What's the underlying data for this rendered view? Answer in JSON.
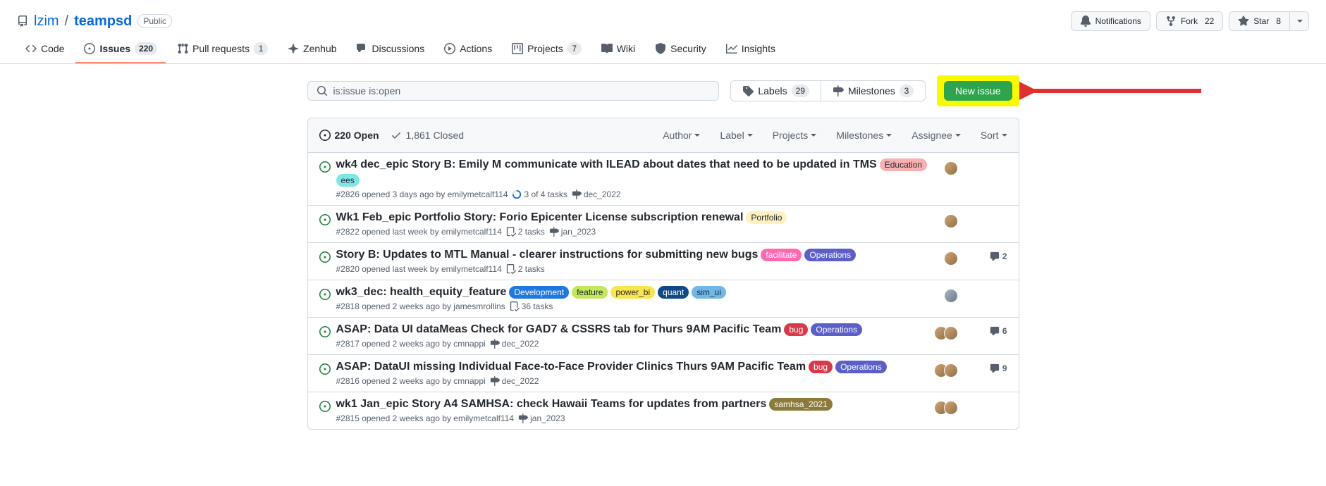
{
  "repo": {
    "owner": "lzim",
    "name": "teampsd",
    "visibility": "Public"
  },
  "headerButtons": {
    "notifications": "Notifications",
    "fork": "Fork",
    "fork_count": "22",
    "star": "Star",
    "star_count": "8"
  },
  "tabs": [
    {
      "label": "Code",
      "icon": "code"
    },
    {
      "label": "Issues",
      "icon": "issue",
      "count": "220",
      "selected": true
    },
    {
      "label": "Pull requests",
      "icon": "pr",
      "count": "1"
    },
    {
      "label": "Zenhub",
      "icon": "zenhub"
    },
    {
      "label": "Discussions",
      "icon": "discussion"
    },
    {
      "label": "Actions",
      "icon": "play"
    },
    {
      "label": "Projects",
      "icon": "project",
      "count": "7"
    },
    {
      "label": "Wiki",
      "icon": "book"
    },
    {
      "label": "Security",
      "icon": "shield"
    },
    {
      "label": "Insights",
      "icon": "graph"
    }
  ],
  "search": {
    "value": "is:issue is:open"
  },
  "filterButtons": {
    "labels": "Labels",
    "labels_count": "29",
    "milestones": "Milestones",
    "milestones_count": "3"
  },
  "newIssue": "New issue",
  "states": {
    "open": "220 Open",
    "closed": "1,861 Closed"
  },
  "sortFilters": [
    "Author",
    "Label",
    "Projects",
    "Milestones",
    "Assignee",
    "Sort"
  ],
  "issues": [
    {
      "title": "wk4 dec_epic Story B: Emily M communicate with ILEAD about dates that need to be updated in TMS",
      "labels": [
        {
          "text": "Education",
          "bg": "#f8b0b0",
          "fg": "#24292f"
        },
        {
          "text": "ees",
          "bg": "#7fe6e6",
          "fg": "#24292f"
        }
      ],
      "meta": "#2826 opened 3 days ago by emilymetcalf114",
      "tasks": {
        "kind": "progress",
        "text": "3 of 4 tasks"
      },
      "milestone": "dec_2022",
      "assignees": 1,
      "comments": null
    },
    {
      "title": "Wk1 Feb_epic Portfolio Story: Forio Epicenter License subscription renewal",
      "labels": [
        {
          "text": "Portfolio",
          "bg": "#fef2c0",
          "fg": "#24292f"
        }
      ],
      "meta": "#2822 opened last week by emilymetcalf114",
      "tasks": {
        "kind": "check",
        "text": "2 tasks"
      },
      "milestone": "jan_2023",
      "assignees": 1,
      "comments": null
    },
    {
      "title": "Story B: Updates to MTL Manual - clearer instructions for submitting new bugs",
      "labels": [
        {
          "text": "facilitate",
          "bg": "#ff69b4",
          "fg": "#fff"
        },
        {
          "text": "Operations",
          "bg": "#5b5fc7",
          "fg": "#fff"
        }
      ],
      "meta": "#2820 opened last week by emilymetcalf114",
      "tasks": {
        "kind": "check",
        "text": "2 tasks"
      },
      "milestone": null,
      "assignees": 1,
      "comments": 2
    },
    {
      "title": "wk3_dec: health_equity_feature",
      "labels": [
        {
          "text": "Development",
          "bg": "#1f77e0",
          "fg": "#fff"
        },
        {
          "text": "feature",
          "bg": "#c2e85b",
          "fg": "#24292f"
        },
        {
          "text": "power_bi",
          "bg": "#f9e64f",
          "fg": "#24292f"
        },
        {
          "text": "quant",
          "bg": "#0e4a8a",
          "fg": "#fff"
        },
        {
          "text": "sim_ui",
          "bg": "#6fb8e8",
          "fg": "#24292f"
        }
      ],
      "meta": "#2818 opened 2 weeks ago by jamesmrollins",
      "tasks": {
        "kind": "check",
        "text": "36 tasks"
      },
      "milestone": null,
      "assignees": 1,
      "assignee_male": true,
      "comments": null
    },
    {
      "title": "ASAP: Data UI dataMeas Check for GAD7 & CSSRS tab for Thurs 9AM Pacific Team",
      "labels": [
        {
          "text": "bug",
          "bg": "#d73a4a",
          "fg": "#fff"
        },
        {
          "text": "Operations",
          "bg": "#5b5fc7",
          "fg": "#fff"
        }
      ],
      "meta": "#2817 opened 2 weeks ago by cmnappi",
      "tasks": null,
      "milestone": "dec_2022",
      "assignees": 2,
      "comments": 6
    },
    {
      "title": "ASAP: DataUI missing Individual Face-to-Face Provider Clinics Thurs 9AM Pacific Team",
      "labels": [
        {
          "text": "bug",
          "bg": "#d73a4a",
          "fg": "#fff"
        },
        {
          "text": "Operations",
          "bg": "#5b5fc7",
          "fg": "#fff"
        }
      ],
      "meta": "#2816 opened 2 weeks ago by cmnappi",
      "tasks": null,
      "milestone": "dec_2022",
      "assignees": 2,
      "comments": 9
    },
    {
      "title": "wk1 Jan_epic Story A4 SAMHSA: check Hawaii Teams for updates from partners",
      "labels": [
        {
          "text": "samhsa_2021",
          "bg": "#8b7a3a",
          "fg": "#fff"
        }
      ],
      "meta": "#2815 opened 2 weeks ago by emilymetcalf114",
      "tasks": null,
      "milestone": "jan_2023",
      "assignees": 2,
      "comments": null
    }
  ]
}
